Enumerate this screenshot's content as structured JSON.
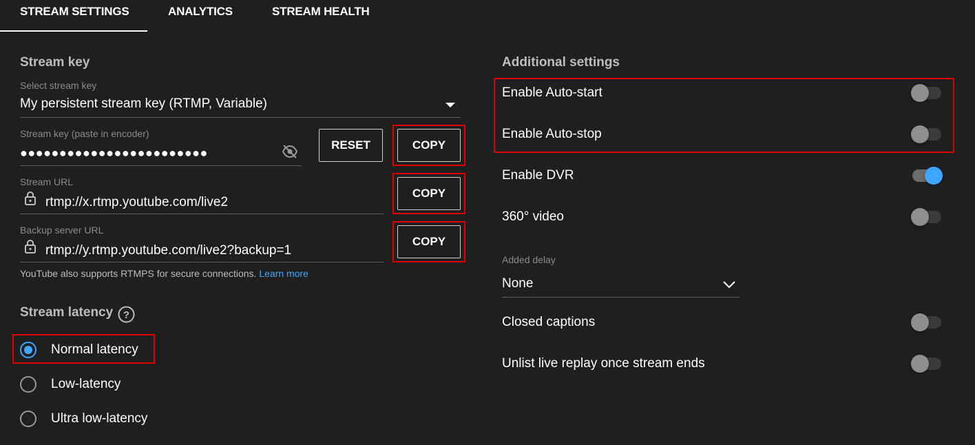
{
  "tabs": [
    {
      "label": "STREAM SETTINGS",
      "active": true
    },
    {
      "label": "ANALYTICS",
      "active": false
    },
    {
      "label": "STREAM HEALTH",
      "active": false
    }
  ],
  "stream_key": {
    "title": "Stream key",
    "select_label": "Select stream key",
    "selected_key": "My persistent stream key (RTMP, Variable)",
    "key_label": "Stream key (paste in encoder)",
    "key_masked": "●●●●●●●●●●●●●●●●●●●●●●●●",
    "reset_label": "RESET",
    "copy_label": "COPY",
    "url_label": "Stream URL",
    "url_value": "rtmp://x.rtmp.youtube.com/live2",
    "backup_label": "Backup server URL",
    "backup_value": "rtmp://y.rtmp.youtube.com/live2?backup=1",
    "helper_text": "YouTube also supports RTMPS for secure connections.",
    "learn_more": "Learn more"
  },
  "latency": {
    "title": "Stream latency",
    "help_icon": "?",
    "options": [
      {
        "label": "Normal latency",
        "checked": true
      },
      {
        "label": "Low-latency",
        "checked": false
      },
      {
        "label": "Ultra low-latency",
        "checked": false
      }
    ]
  },
  "additional": {
    "title": "Additional settings",
    "settings": [
      {
        "label": "Enable Auto-start",
        "on": false
      },
      {
        "label": "Enable Auto-stop",
        "on": false
      },
      {
        "label": "Enable DVR",
        "on": true
      },
      {
        "label": "360° video",
        "on": false
      }
    ],
    "delay_label": "Added delay",
    "delay_value": "None",
    "closed_captions": {
      "label": "Closed captions",
      "on": false
    },
    "unlist": {
      "label": "Unlist live replay once stream ends",
      "on": false
    }
  },
  "colors": {
    "background": "#1f1f1f",
    "accent": "#3ea6ff",
    "highlight_box": "#e00000"
  }
}
